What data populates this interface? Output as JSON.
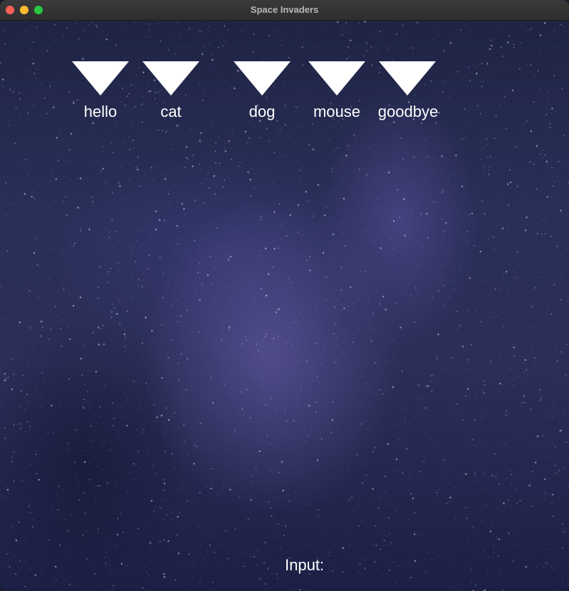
{
  "window": {
    "title": "Space Invaders",
    "controls": [
      "close",
      "minimize",
      "maximize"
    ]
  },
  "invaders": [
    {
      "word": "hello",
      "icon": "triangle-invader-icon"
    },
    {
      "word": "cat",
      "icon": "triangle-invader-icon"
    },
    {
      "word": "dog",
      "icon": "triangle-invader-icon"
    },
    {
      "word": "mouse",
      "icon": "triangle-invader-icon"
    },
    {
      "word": "goodbye",
      "icon": "triangle-invader-icon"
    }
  ],
  "input": {
    "label": "Input:",
    "value": ""
  },
  "colors": {
    "invader": "#ffffff",
    "text": "#ffffff",
    "background": "#2a2f5a"
  }
}
